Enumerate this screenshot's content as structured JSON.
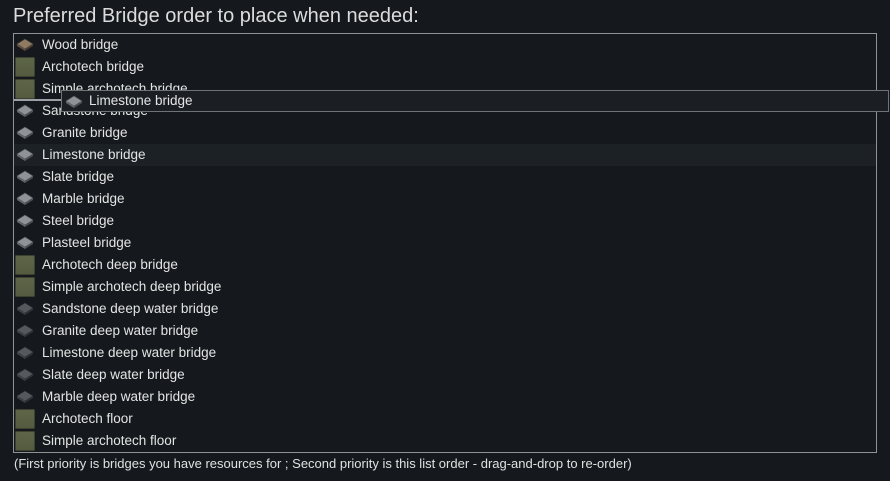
{
  "title": "Preferred Bridge order to place when needed:",
  "bridges": [
    {
      "label": "Wood bridge",
      "icon": "wood-bridge-icon",
      "style": "wood"
    },
    {
      "label": "Archotech bridge",
      "icon": "archotech-bridge-icon",
      "style": "archo"
    },
    {
      "label": "Simple archotech bridge",
      "icon": "simple-archotech-bridge-icon",
      "style": "archo"
    },
    {
      "label": "Sandstone bridge",
      "icon": "sandstone-bridge-icon",
      "style": "stone"
    },
    {
      "label": "Granite bridge",
      "icon": "granite-bridge-icon",
      "style": "stone"
    },
    {
      "label": "Limestone bridge",
      "icon": "limestone-bridge-icon",
      "style": "stone"
    },
    {
      "label": "Slate bridge",
      "icon": "slate-bridge-icon",
      "style": "stone"
    },
    {
      "label": "Marble bridge",
      "icon": "marble-bridge-icon",
      "style": "stone"
    },
    {
      "label": "Steel bridge",
      "icon": "steel-bridge-icon",
      "style": "stone"
    },
    {
      "label": "Plasteel bridge",
      "icon": "plasteel-bridge-icon",
      "style": "stone"
    },
    {
      "label": "Archotech deep bridge",
      "icon": "archotech-deep-bridge-icon",
      "style": "archo"
    },
    {
      "label": "Simple archotech deep bridge",
      "icon": "simple-archotech-deep-bridge-icon",
      "style": "archo"
    },
    {
      "label": "Sandstone deep water bridge",
      "icon": "sandstone-deep-water-bridge-icon",
      "style": "dark"
    },
    {
      "label": "Granite deep water bridge",
      "icon": "granite-deep-water-bridge-icon",
      "style": "dark"
    },
    {
      "label": "Limestone deep water bridge",
      "icon": "limestone-deep-water-bridge-icon",
      "style": "dark"
    },
    {
      "label": "Slate deep water bridge",
      "icon": "slate-deep-water-bridge-icon",
      "style": "dark"
    },
    {
      "label": "Marble deep water bridge",
      "icon": "marble-deep-water-bridge-icon",
      "style": "dark"
    },
    {
      "label": "Archotech floor",
      "icon": "archotech-floor-icon",
      "style": "archo"
    },
    {
      "label": "Simple archotech floor",
      "icon": "simple-archotech-floor-icon",
      "style": "archo"
    }
  ],
  "dragging": {
    "label": "Limestone bridge",
    "icon": "limestone-bridge-icon"
  },
  "footnote": "(First priority is bridges you have resources for ; Second priority is this list order - drag-and-drop to re-order)",
  "colors": {
    "background": "#15191d",
    "frame_border": "#8f9296",
    "archotech_tile": "#5a6144",
    "row_highlight": "#1c2126"
  }
}
